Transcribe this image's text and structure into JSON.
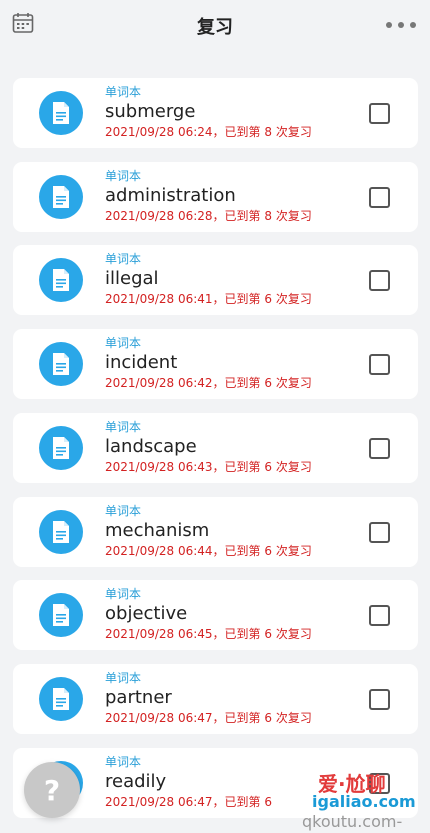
{
  "header": {
    "title": "复习",
    "left_icon": "calendar-icon",
    "right_icon": "more-dots-icon"
  },
  "items": [
    {
      "book": "单词本",
      "word": "submerge",
      "status": "2021/09/28 06:24，已到第 8 次复习",
      "checked": false
    },
    {
      "book": "单词本",
      "word": "administration",
      "status": "2021/09/28 06:28，已到第 8 次复习",
      "checked": false
    },
    {
      "book": "单词本",
      "word": "illegal",
      "status": "2021/09/28 06:41，已到第 6 次复习",
      "checked": false
    },
    {
      "book": "单词本",
      "word": "incident",
      "status": "2021/09/28 06:42，已到第 6 次复习",
      "checked": false
    },
    {
      "book": "单词本",
      "word": "landscape",
      "status": "2021/09/28 06:43，已到第 6 次复习",
      "checked": false
    },
    {
      "book": "单词本",
      "word": "mechanism",
      "status": "2021/09/28 06:44，已到第 6 次复习",
      "checked": false
    },
    {
      "book": "单词本",
      "word": "objective",
      "status": "2021/09/28 06:45，已到第 6 次复习",
      "checked": false
    },
    {
      "book": "单词本",
      "word": "partner",
      "status": "2021/09/28 06:47，已到第 6 次复习",
      "checked": false
    },
    {
      "book": "单词本",
      "word": "readily",
      "status": "2021/09/28 06:47，已到第 6",
      "checked": false
    }
  ],
  "help_button": {
    "label": "?"
  },
  "watermark": {
    "line1": "爱·尬聊",
    "line2": "igaliao.com",
    "line3": "qkoutu.com-"
  },
  "colors": {
    "accent": "#2aa7e8",
    "status": "#d32222",
    "book": "#2a9fd8"
  }
}
